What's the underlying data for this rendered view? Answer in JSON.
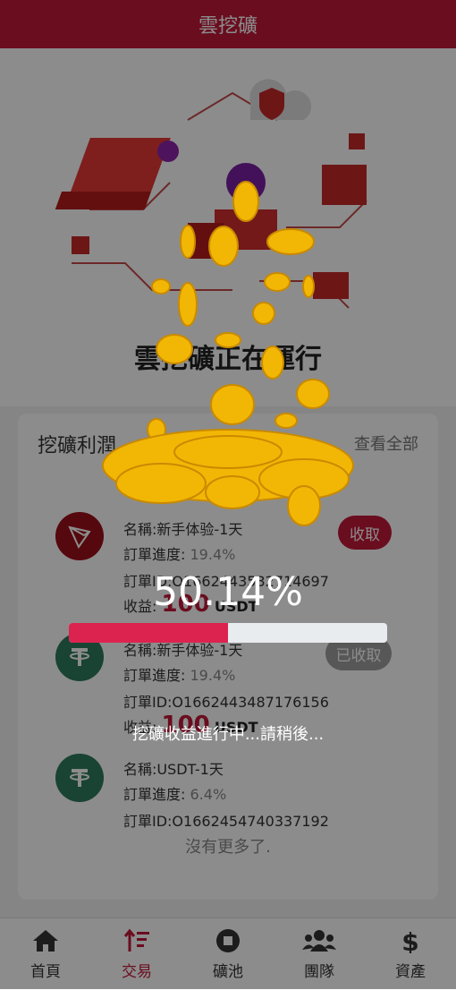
{
  "header": {
    "title": "雲挖礦"
  },
  "hero": {
    "status_text": "雲挖礦正在運行"
  },
  "profit": {
    "title": "挖礦利潤",
    "view_all": "查看全部",
    "orders": [
      {
        "name": "名稱:新手体验-1天",
        "progress_label": "訂單進度:",
        "progress_value": "19.4%",
        "order_id": "訂單ID:O1662443532714697",
        "income_label": "收益:",
        "income_amount": "100",
        "income_unit": "USDT",
        "button": "收取",
        "coin": "tron"
      },
      {
        "name": "名稱:新手体验-1天",
        "progress_label": "訂單進度:",
        "progress_value": "19.4%",
        "order_id": "訂單ID:O1662443487176156",
        "income_label": "收益:",
        "income_amount": "100",
        "income_unit": "USDT",
        "button": "已收取",
        "coin": "tether"
      },
      {
        "name": "名稱:USDT-1天",
        "progress_label": "訂單進度:",
        "progress_value": "6.4%",
        "order_id": "訂單ID:O1662454740337192",
        "coin": "tether"
      }
    ],
    "no_more": "沒有更多了."
  },
  "overlay": {
    "percent_text": "50.14%",
    "progress": 50.14,
    "message": "挖礦收益進行中...請稍後..."
  },
  "tabs": [
    {
      "label": "首頁",
      "icon": "home-icon",
      "active": false
    },
    {
      "label": "交易",
      "icon": "sort-icon",
      "active": true
    },
    {
      "label": "礦池",
      "icon": "stop-circle-icon",
      "active": false
    },
    {
      "label": "團隊",
      "icon": "users-icon",
      "active": false
    },
    {
      "label": "資產",
      "icon": "dollar-icon",
      "active": false
    }
  ],
  "colors": {
    "brand": "#c2183a",
    "progress_fill": "#dc2350",
    "tron": "#9b0f18",
    "tether": "#2f7a5b"
  }
}
